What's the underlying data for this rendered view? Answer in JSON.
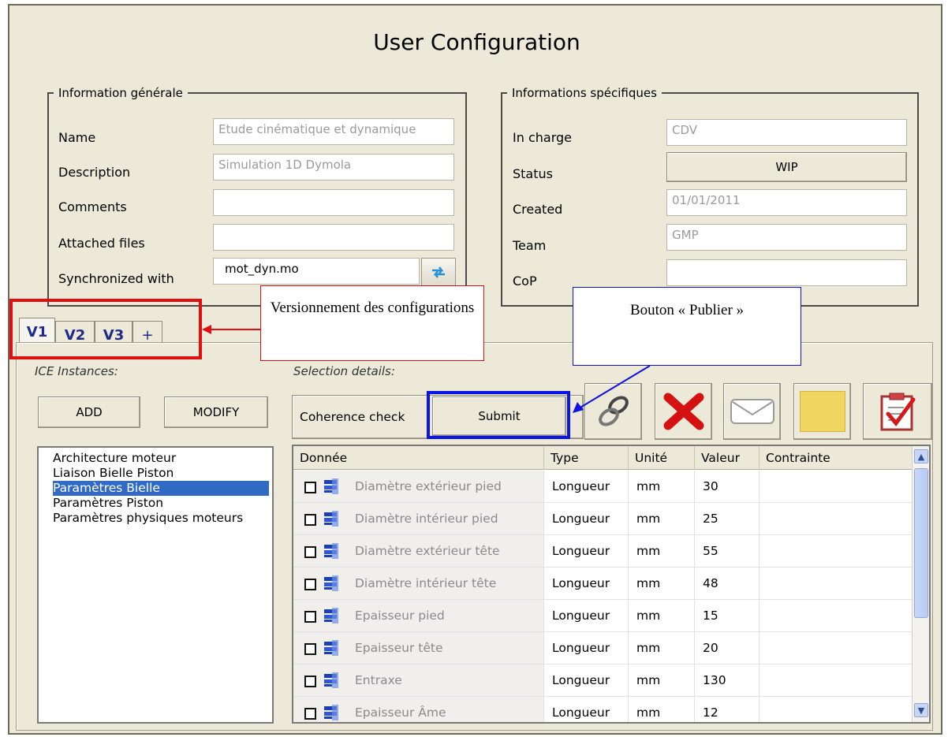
{
  "window": {
    "title": "User Configuration"
  },
  "general_info": {
    "legend": "Information générale",
    "fields": [
      {
        "label": "Name",
        "value": "Etude cinématique et dynamique"
      },
      {
        "label": "Description",
        "value": "Simulation 1D Dymola"
      },
      {
        "label": "Comments",
        "value": ""
      },
      {
        "label": "Attached files",
        "value": ""
      },
      {
        "label": "Synchronized with",
        "value": "mot_dyn.mo"
      }
    ],
    "sync_icon": "sync-arrows-icon"
  },
  "specific_info": {
    "legend": "Informations spécifiques",
    "fields": [
      {
        "label": "In charge",
        "value": "CDV"
      },
      {
        "label": "Status",
        "value": "WIP"
      },
      {
        "label": "Created",
        "value": "01/01/2011"
      },
      {
        "label": "Team",
        "value": "GMP"
      },
      {
        "label": "CoP",
        "value": ""
      }
    ]
  },
  "tabs": [
    "V1",
    "V2",
    "V3",
    "+"
  ],
  "callouts": {
    "versioning": "Versionnement des configurations",
    "publish": "Bouton « Publier »"
  },
  "instances": {
    "label": "ICE Instances:",
    "add_label": "ADD",
    "modify_label": "MODIFY",
    "items": [
      "Architecture moteur",
      "Liaison Bielle Piston",
      "Paramètres Bielle",
      "Paramètres Piston",
      "Paramètres physiques moteurs"
    ],
    "selected": "Paramètres Bielle"
  },
  "details": {
    "label": "Selection details:",
    "coherence_label": "Coherence check",
    "submit_label": "Submit",
    "toolbar_icons": [
      "link-icon",
      "delete-x-icon",
      "mail-icon",
      "note-icon",
      "checklist-icon"
    ]
  },
  "table": {
    "headers": [
      "Donnée",
      "Type",
      "Unité",
      "Valeur",
      "Contrainte"
    ],
    "rows": [
      {
        "name": "Diamètre extérieur pied",
        "type": "Longueur",
        "unit": "mm",
        "value": "30",
        "constraint": ""
      },
      {
        "name": "Diamètre intérieur pied",
        "type": "Longueur",
        "unit": "mm",
        "value": "25",
        "constraint": ""
      },
      {
        "name": "Diamètre extérieur tête",
        "type": "Longueur",
        "unit": "mm",
        "value": "55",
        "constraint": ""
      },
      {
        "name": "Diamètre intérieur tête",
        "type": "Longueur",
        "unit": "mm",
        "value": "48",
        "constraint": ""
      },
      {
        "name": "Epaisseur pied",
        "type": "Longueur",
        "unit": "mm",
        "value": "15",
        "constraint": ""
      },
      {
        "name": "Epaisseur tête",
        "type": "Longueur",
        "unit": "mm",
        "value": "20",
        "constraint": ""
      },
      {
        "name": "Entraxe",
        "type": "Longueur",
        "unit": "mm",
        "value": "130",
        "constraint": ""
      },
      {
        "name": "Epaisseur Âme",
        "type": "Longueur",
        "unit": "mm",
        "value": "12",
        "constraint": ""
      }
    ]
  },
  "colors": {
    "window_bg": "#ece9d8",
    "selection_blue": "#316ac5",
    "callout_red": "#e01010",
    "callout_blue": "#1010e0",
    "tab_text": "#1f2a8a"
  }
}
